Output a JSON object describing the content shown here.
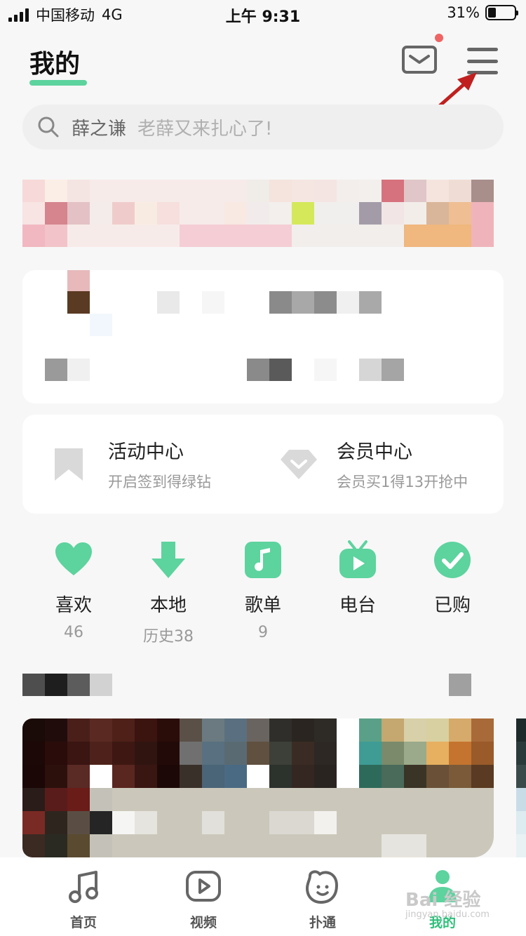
{
  "status_bar": {
    "carrier": "中国移动",
    "network": "4G",
    "time": "上午 9:31",
    "battery_percent": "31%",
    "battery_level": 0.31
  },
  "header": {
    "title": "我的",
    "accent_color": "#5dd39e",
    "notification_dot_color": "#f06464"
  },
  "search": {
    "user_name": "薛之谦",
    "hint": "老薛又来扎心了!"
  },
  "features": [
    {
      "title": "活动中心",
      "subtitle": "开启签到得绿钻",
      "icon": "bookmark-icon"
    },
    {
      "title": "会员中心",
      "subtitle": "会员买1得13开抢中",
      "icon": "diamond-icon"
    }
  ],
  "quick_items": [
    {
      "label": "喜欢",
      "count": "46",
      "icon": "heart-icon"
    },
    {
      "label": "本地",
      "count": "历史38",
      "icon": "download-icon"
    },
    {
      "label": "歌单",
      "count": "9",
      "icon": "playlist-icon"
    },
    {
      "label": "电台",
      "count": "",
      "icon": "radio-icon"
    },
    {
      "label": "已购",
      "count": "",
      "icon": "purchased-icon"
    }
  ],
  "bottom_nav": [
    {
      "label": "首页",
      "icon": "music-note-icon",
      "active": false
    },
    {
      "label": "视频",
      "icon": "video-play-icon",
      "active": false
    },
    {
      "label": "扑通",
      "icon": "social-face-icon",
      "active": false
    },
    {
      "label": "我的",
      "icon": "profile-icon",
      "active": true
    }
  ],
  "watermark": {
    "text": "Bai 经验",
    "url": "jingyan.baidu.com"
  }
}
